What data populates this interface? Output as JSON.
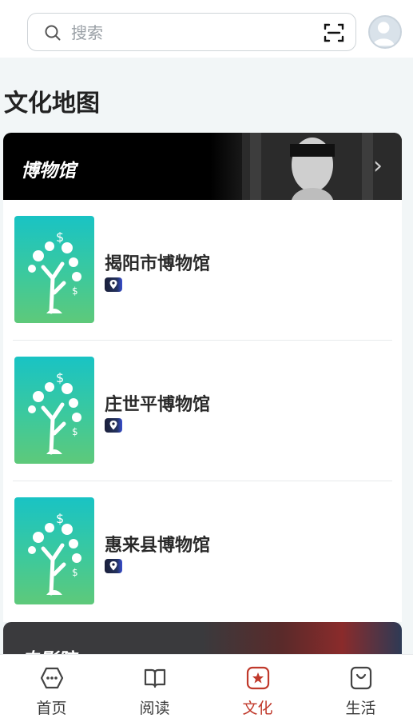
{
  "search": {
    "placeholder": "搜索",
    "value": ""
  },
  "page_title": "文化地图",
  "museum_card": {
    "banner_title": "博物馆",
    "items": [
      {
        "name": "揭阳市博物馆"
      },
      {
        "name": "庄世平博物馆"
      },
      {
        "name": "惠来县博物馆"
      }
    ]
  },
  "cinema_card": {
    "banner_title": "电影院"
  },
  "tabs": [
    {
      "label": "首页",
      "icon": "home-icon"
    },
    {
      "label": "阅读",
      "icon": "book-icon"
    },
    {
      "label": "文化",
      "icon": "star-icon",
      "active": true
    },
    {
      "label": "生活",
      "icon": "bag-icon"
    }
  ],
  "colors": {
    "active_tab": "#c0392b",
    "thumb_top": "#19c3c4",
    "thumb_bottom": "#5ec97a"
  }
}
